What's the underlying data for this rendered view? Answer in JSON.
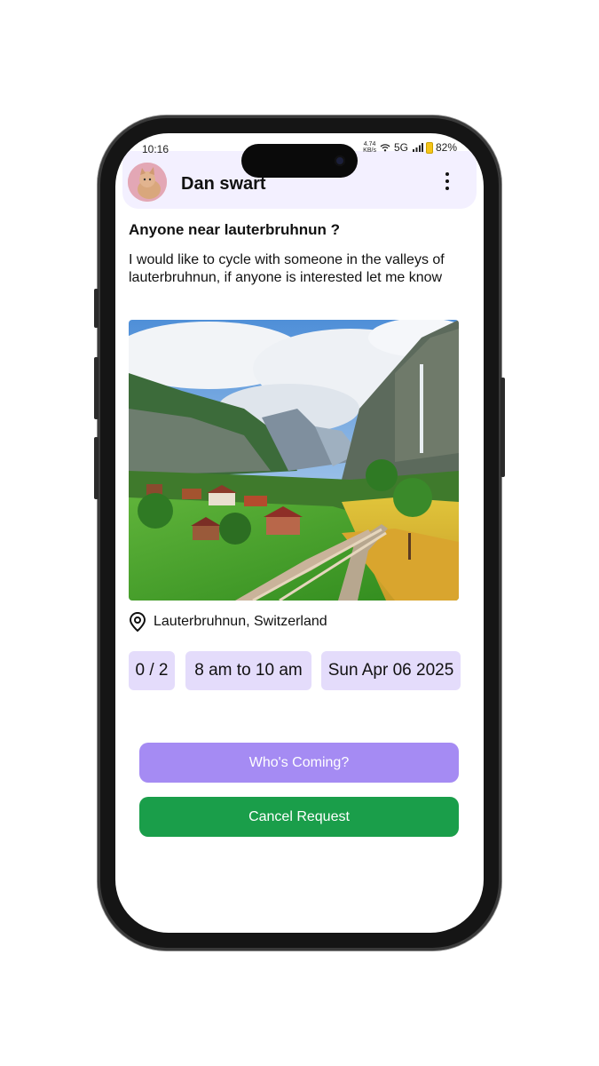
{
  "status_bar": {
    "time": "10:16",
    "net_speed_value": "4.74",
    "net_speed_unit": "KB/s",
    "network": "5G",
    "battery": "82%"
  },
  "header": {
    "username": "Dan swart",
    "avatar_icon": "cat-avatar",
    "menu_icon": "more-vertical-icon"
  },
  "post": {
    "title": "Anyone near lauterbruhnun ?",
    "body": "I would like to cycle with someone in the valleys of lauterbruhnun, if anyone is interested let me know",
    "image": "alpine-valley-village-photo",
    "location": "Lauterbruhnun, Switzerland",
    "participants": "0 / 2",
    "time_range": "8 am to 10 am",
    "date": "Sun Apr 06 2025"
  },
  "actions": {
    "whos_coming": "Who's Coming?",
    "cancel_request": "Cancel Request"
  },
  "colors": {
    "header_bg": "#f3f0ff",
    "chip_bg": "#e4dcfb",
    "whos_coming_bg": "#a58bf3",
    "cancel_bg": "#1a9e4a"
  }
}
